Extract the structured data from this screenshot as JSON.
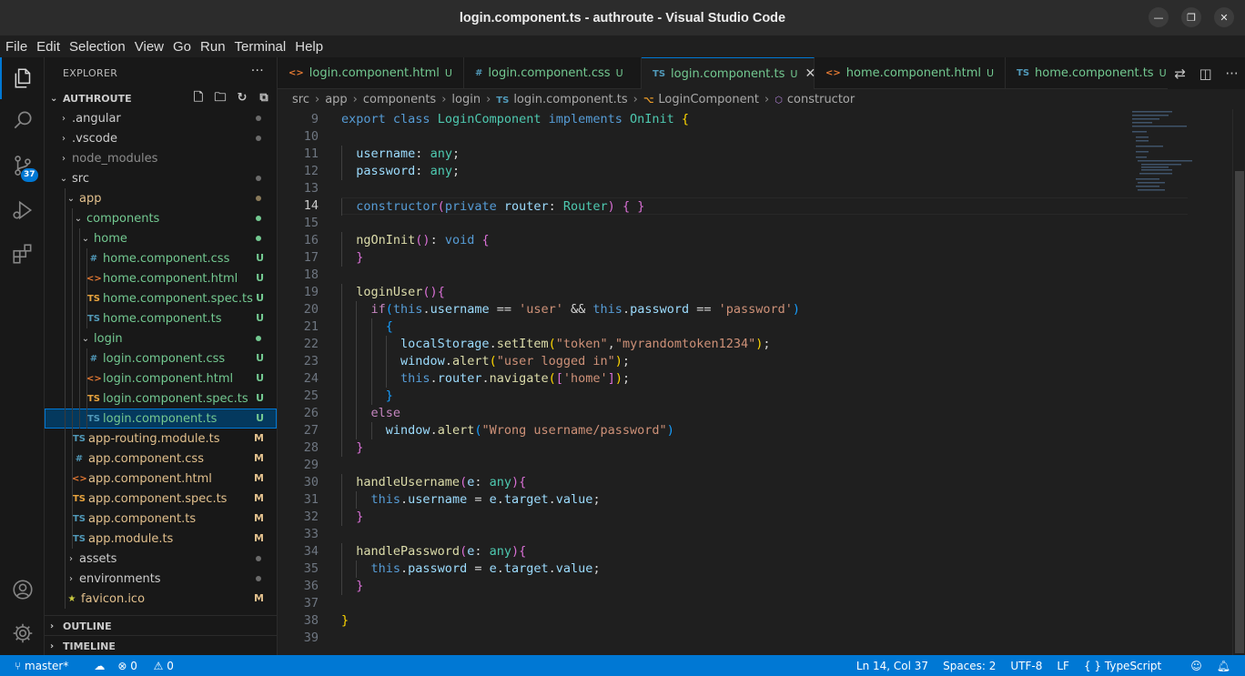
{
  "window": {
    "title": "login.component.ts - authroute - Visual Studio Code"
  },
  "menu": [
    "File",
    "Edit",
    "Selection",
    "View",
    "Go",
    "Run",
    "Terminal",
    "Help"
  ],
  "activity": {
    "scm_badge": "37"
  },
  "sidebar": {
    "title": "EXPLORER",
    "more": "···",
    "project": "AUTHROUTE",
    "tree": [
      {
        "label": ".angular",
        "level": 1,
        "folder": true,
        "open": false,
        "color": "normal",
        "status": "dot-dim"
      },
      {
        "label": ".vscode",
        "level": 1,
        "folder": true,
        "open": false,
        "color": "normal",
        "status": "dot-dim"
      },
      {
        "label": "node_modules",
        "level": 1,
        "folder": true,
        "open": false,
        "color": "dim",
        "status": ""
      },
      {
        "label": "src",
        "level": 1,
        "folder": true,
        "open": true,
        "color": "normal",
        "status": "dot-dim"
      },
      {
        "label": "app",
        "level": 2,
        "folder": true,
        "open": true,
        "color": "modified",
        "status": "dot-mod"
      },
      {
        "label": "components",
        "level": 3,
        "folder": true,
        "open": true,
        "color": "untracked",
        "status": "dot-un"
      },
      {
        "label": "home",
        "level": 4,
        "folder": true,
        "open": true,
        "color": "untracked",
        "status": "dot-un"
      },
      {
        "label": "home.component.css",
        "level": 5,
        "icon": "#",
        "iconColor": "#519aba",
        "color": "untracked",
        "status": "U"
      },
      {
        "label": "home.component.html",
        "level": 5,
        "icon": "<>",
        "iconColor": "#e37933",
        "color": "untracked",
        "status": "U"
      },
      {
        "label": "home.component.spec.ts",
        "level": 5,
        "icon": "TS",
        "iconColor": "#e8a33d",
        "color": "untracked",
        "status": "U"
      },
      {
        "label": "home.component.ts",
        "level": 5,
        "icon": "TS",
        "iconColor": "#519aba",
        "color": "untracked",
        "status": "U"
      },
      {
        "label": "login",
        "level": 4,
        "folder": true,
        "open": true,
        "color": "untracked",
        "status": "dot-un"
      },
      {
        "label": "login.component.css",
        "level": 5,
        "icon": "#",
        "iconColor": "#519aba",
        "color": "untracked",
        "status": "U"
      },
      {
        "label": "login.component.html",
        "level": 5,
        "icon": "<>",
        "iconColor": "#e37933",
        "color": "untracked",
        "status": "U"
      },
      {
        "label": "login.component.spec.ts",
        "level": 5,
        "icon": "TS",
        "iconColor": "#e8a33d",
        "color": "untracked",
        "status": "U"
      },
      {
        "label": "login.component.ts",
        "level": 5,
        "icon": "TS",
        "iconColor": "#519aba",
        "color": "untracked",
        "status": "U",
        "selected": true
      },
      {
        "label": "app-routing.module.ts",
        "level": 3,
        "icon": "TS",
        "iconColor": "#519aba",
        "color": "modified",
        "status": "M"
      },
      {
        "label": "app.component.css",
        "level": 3,
        "icon": "#",
        "iconColor": "#519aba",
        "color": "modified",
        "status": "M"
      },
      {
        "label": "app.component.html",
        "level": 3,
        "icon": "<>",
        "iconColor": "#e37933",
        "color": "modified",
        "status": "M"
      },
      {
        "label": "app.component.spec.ts",
        "level": 3,
        "icon": "TS",
        "iconColor": "#e8a33d",
        "color": "modified",
        "status": "M"
      },
      {
        "label": "app.component.ts",
        "level": 3,
        "icon": "TS",
        "iconColor": "#519aba",
        "color": "modified",
        "status": "M"
      },
      {
        "label": "app.module.ts",
        "level": 3,
        "icon": "TS",
        "iconColor": "#519aba",
        "color": "modified",
        "status": "M"
      },
      {
        "label": "assets",
        "level": 2,
        "folder": true,
        "open": false,
        "color": "normal",
        "status": "dot-dim"
      },
      {
        "label": "environments",
        "level": 2,
        "folder": true,
        "open": false,
        "color": "normal",
        "status": "dot-dim"
      },
      {
        "label": "favicon.ico",
        "level": 2,
        "icon": "★",
        "iconColor": "#cbcb41",
        "color": "modified",
        "status": "M"
      }
    ],
    "outline": "OUTLINE",
    "timeline": "TIMELINE"
  },
  "tabs": [
    {
      "label": "login.component.html",
      "icon": "<>",
      "iconColor": "#e37933",
      "status": "U",
      "active": false
    },
    {
      "label": "login.component.css",
      "icon": "#",
      "iconColor": "#519aba",
      "status": "U",
      "active": false
    },
    {
      "label": "login.component.ts",
      "icon": "TS",
      "iconColor": "#519aba",
      "status": "U",
      "active": true
    },
    {
      "label": "home.component.html",
      "icon": "<>",
      "iconColor": "#e37933",
      "status": "U",
      "active": false
    },
    {
      "label": "home.component.ts",
      "icon": "TS",
      "iconColor": "#519aba",
      "status": "U",
      "active": false
    }
  ],
  "breadcrumbs": [
    "src",
    "app",
    "components",
    "login",
    "login.component.ts",
    "LoginComponent",
    "constructor"
  ],
  "editor": {
    "first_line": 9,
    "current_line": 14,
    "lines": [
      [
        [
          "export ",
          "k"
        ],
        [
          "class ",
          "k"
        ],
        [
          "LoginComponent ",
          "cl"
        ],
        [
          "implements ",
          "k"
        ],
        [
          "OnInit ",
          "cl"
        ],
        [
          "{",
          "b1"
        ]
      ],
      [],
      [
        [
          "  "
        ],
        [
          "username",
          "v"
        ],
        [
          ": ",
          "p"
        ],
        [
          "any",
          "cl"
        ],
        [
          ";",
          "p"
        ]
      ],
      [
        [
          "  "
        ],
        [
          "password",
          "v"
        ],
        [
          ": ",
          "p"
        ],
        [
          "any",
          "cl"
        ],
        [
          ";",
          "p"
        ]
      ],
      [],
      [
        [
          "  "
        ],
        [
          "constructor",
          "k"
        ],
        [
          "(",
          "b2"
        ],
        [
          "private ",
          "k"
        ],
        [
          "router",
          "v"
        ],
        [
          ": ",
          "p"
        ],
        [
          "Router",
          "cl"
        ],
        [
          ")",
          "b2"
        ],
        [
          " "
        ],
        [
          "{ }",
          "b2"
        ]
      ],
      [],
      [
        [
          "  "
        ],
        [
          "ngOnInit",
          "f"
        ],
        [
          "()",
          "b2"
        ],
        [
          ": ",
          "p"
        ],
        [
          "void ",
          "k"
        ],
        [
          "{",
          "b2"
        ]
      ],
      [
        [
          "  "
        ],
        [
          "}",
          "b2"
        ]
      ],
      [],
      [
        [
          "  "
        ],
        [
          "loginUser",
          "f"
        ],
        [
          "()",
          "b2"
        ],
        [
          "{",
          "b2"
        ]
      ],
      [
        [
          "    "
        ],
        [
          "if",
          "c"
        ],
        [
          "(",
          "b3"
        ],
        [
          "this",
          "k"
        ],
        [
          ".",
          "p"
        ],
        [
          "username",
          "v"
        ],
        [
          " == ",
          "p"
        ],
        [
          "'user'",
          "s"
        ],
        [
          " && ",
          "p"
        ],
        [
          "this",
          "k"
        ],
        [
          ".",
          "p"
        ],
        [
          "password",
          "v"
        ],
        [
          " == ",
          "p"
        ],
        [
          "'password'",
          "s"
        ],
        [
          ")",
          "b3"
        ]
      ],
      [
        [
          "      "
        ],
        [
          "{",
          "b3"
        ]
      ],
      [
        [
          "        "
        ],
        [
          "localStorage",
          "v"
        ],
        [
          ".",
          "p"
        ],
        [
          "setItem",
          "f"
        ],
        [
          "(",
          "b1"
        ],
        [
          "\"token\"",
          "s"
        ],
        [
          ",",
          "p"
        ],
        [
          "\"myrandomtoken1234\"",
          "s"
        ],
        [
          ")",
          "b1"
        ],
        [
          ";",
          "p"
        ]
      ],
      [
        [
          "        "
        ],
        [
          "window",
          "v"
        ],
        [
          ".",
          "p"
        ],
        [
          "alert",
          "f"
        ],
        [
          "(",
          "b1"
        ],
        [
          "\"user logged in\"",
          "s"
        ],
        [
          ")",
          "b1"
        ],
        [
          ";",
          "p"
        ]
      ],
      [
        [
          "        "
        ],
        [
          "this",
          "k"
        ],
        [
          ".",
          "p"
        ],
        [
          "router",
          "v"
        ],
        [
          ".",
          "p"
        ],
        [
          "navigate",
          "f"
        ],
        [
          "(",
          "b1"
        ],
        [
          "[",
          "b2"
        ],
        [
          "'home'",
          "s"
        ],
        [
          "]",
          "b2"
        ],
        [
          ")",
          "b1"
        ],
        [
          ";",
          "p"
        ]
      ],
      [
        [
          "      "
        ],
        [
          "}",
          "b3"
        ]
      ],
      [
        [
          "    "
        ],
        [
          "else",
          "c"
        ]
      ],
      [
        [
          "      "
        ],
        [
          "window",
          "v"
        ],
        [
          ".",
          "p"
        ],
        [
          "alert",
          "f"
        ],
        [
          "(",
          "b3"
        ],
        [
          "\"Wrong username/password\"",
          "s"
        ],
        [
          ")",
          "b3"
        ]
      ],
      [
        [
          "  "
        ],
        [
          "}",
          "b2"
        ]
      ],
      [],
      [
        [
          "  "
        ],
        [
          "handleUsername",
          "f"
        ],
        [
          "(",
          "b2"
        ],
        [
          "e",
          "v"
        ],
        [
          ": ",
          "p"
        ],
        [
          "any",
          "cl"
        ],
        [
          ")",
          "b2"
        ],
        [
          "{",
          "b2"
        ]
      ],
      [
        [
          "    "
        ],
        [
          "this",
          "k"
        ],
        [
          ".",
          "p"
        ],
        [
          "username",
          "v"
        ],
        [
          " = ",
          "p"
        ],
        [
          "e",
          "v"
        ],
        [
          ".",
          "p"
        ],
        [
          "target",
          "v"
        ],
        [
          ".",
          "p"
        ],
        [
          "value",
          "v"
        ],
        [
          ";",
          "p"
        ]
      ],
      [
        [
          "  "
        ],
        [
          "}",
          "b2"
        ]
      ],
      [],
      [
        [
          "  "
        ],
        [
          "handlePassword",
          "f"
        ],
        [
          "(",
          "b2"
        ],
        [
          "e",
          "v"
        ],
        [
          ": ",
          "p"
        ],
        [
          "any",
          "cl"
        ],
        [
          ")",
          "b2"
        ],
        [
          "{",
          "b2"
        ]
      ],
      [
        [
          "    "
        ],
        [
          "this",
          "k"
        ],
        [
          ".",
          "p"
        ],
        [
          "password",
          "v"
        ],
        [
          " = ",
          "p"
        ],
        [
          "e",
          "v"
        ],
        [
          ".",
          "p"
        ],
        [
          "target",
          "v"
        ],
        [
          ".",
          "p"
        ],
        [
          "value",
          "v"
        ],
        [
          ";",
          "p"
        ]
      ],
      [
        [
          "  "
        ],
        [
          "}",
          "b2"
        ]
      ],
      [],
      [
        [
          "}",
          "b1"
        ]
      ],
      []
    ]
  },
  "status": {
    "branch": "master*",
    "errors": "0",
    "warnings": "0",
    "position": "Ln 14, Col 37",
    "spaces": "Spaces: 2",
    "encoding": "UTF-8",
    "eol": "LF",
    "language": "TypeScript"
  }
}
